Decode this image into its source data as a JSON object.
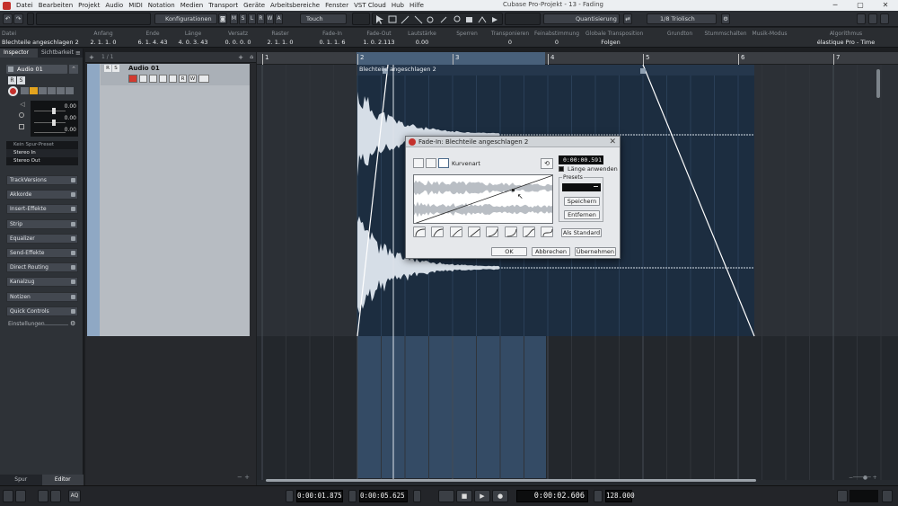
{
  "menubar": {
    "items": [
      "Datei",
      "Bearbeiten",
      "Projekt",
      "Audio",
      "MIDI",
      "Notation",
      "Medien",
      "Transport",
      "Geräte",
      "Arbeitsbereiche",
      "Fenster",
      "VST Cloud",
      "Hub",
      "Hilfe"
    ],
    "window_title": "Cubase Pro-Projekt - 13 - Fading"
  },
  "toolbar": {
    "configurations_label": "Konfigurationen",
    "mode_letters": [
      "M",
      "S",
      "L",
      "R",
      "W",
      "A"
    ],
    "automation_mode": "Touch",
    "quantize_label": "Quantisierung",
    "quantize_value": "1/8 Triolisch"
  },
  "infoline": {
    "columns": [
      {
        "header": "Datei",
        "value": "Blechteile angeschlagen 2"
      },
      {
        "header": "Anfang",
        "value": "2. 1. 1. 0"
      },
      {
        "header": "Ende",
        "value": "6. 1. 4. 43"
      },
      {
        "header": "Länge",
        "value": "4. 0. 3. 43"
      },
      {
        "header": "Versatz",
        "value": "0. 0. 0. 0"
      },
      {
        "header": "Raster",
        "value": "2. 1. 1. 0"
      },
      {
        "header": "Fade-In",
        "value": "0. 1. 1. 6"
      },
      {
        "header": "Fade-Out",
        "value": "1. 0. 2.113"
      },
      {
        "header": "Lautstärke",
        "value": "0.00"
      },
      {
        "header": "Sperren",
        "value": ""
      },
      {
        "header": "Transponieren",
        "value": "0"
      },
      {
        "header": "Feinabstimmung",
        "value": "0"
      },
      {
        "header": "Globale Transposition",
        "value": "Folgen"
      },
      {
        "header": "Grundton",
        "value": ""
      },
      {
        "header": "Stummschalten",
        "value": ""
      },
      {
        "header": "Musik-Modus",
        "value": ""
      },
      {
        "header": "Algorithmus",
        "value": "élastique Pro - Time"
      }
    ]
  },
  "inspector": {
    "tabs": [
      "Inspector",
      "Sichtbarkeit"
    ],
    "track_name": "Audio 01",
    "rs_letters": [
      "R",
      "S"
    ],
    "fader_values": [
      "0.00",
      "0.00",
      "0.00"
    ],
    "routing": [
      "Kein Spur-Preset",
      "Stereo In",
      "Stereo Out"
    ],
    "sections": [
      "TrackVersions",
      "Akkorde",
      "Insert-Effekte",
      "Strip",
      "Equalizer",
      "Send-Effekte",
      "Direct Routing",
      "Kanalzug",
      "Notizen",
      "Quick Controls"
    ],
    "settings_label": "Einstellungen",
    "bottom_tabs": [
      "Spur",
      "Editor"
    ]
  },
  "tracklist": {
    "track_name": "Audio 01",
    "buttons": [
      "R",
      "S",
      "R",
      "W"
    ],
    "counter": "1 / 1"
  },
  "ruler": {
    "bars": [
      "1",
      "2",
      "3",
      "4",
      "5",
      "6",
      "7"
    ]
  },
  "event": {
    "name": "Blechteile angeschlagen 2"
  },
  "dialog": {
    "title": "Fade-In: Blechteile angeschlagen 2",
    "curve_kind_label": "Kurvenart",
    "length_value": "0:00:00.591",
    "apply_length_label": "Länge anwenden",
    "presets_label": "Presets",
    "save_label": "Speichern",
    "remove_label": "Entfernen",
    "default_label": "Als Standard",
    "ok_label": "OK",
    "cancel_label": "Abbrechen",
    "apply_label": "Übernehmen"
  },
  "transport": {
    "left_locator": "0:00:01.875",
    "right_locator": "0:00:05.625",
    "position": "0:00:02.606",
    "tempo": "128.000",
    "aq_label": "AQ"
  },
  "colors": {
    "accent_red": "#c4302b",
    "track_selected": "#8fa8c4",
    "waveform": "#cfd8e2",
    "event_bg": "#1c2d40",
    "fade_line": "#ffffff",
    "locator_range": "#3e5c7d"
  }
}
